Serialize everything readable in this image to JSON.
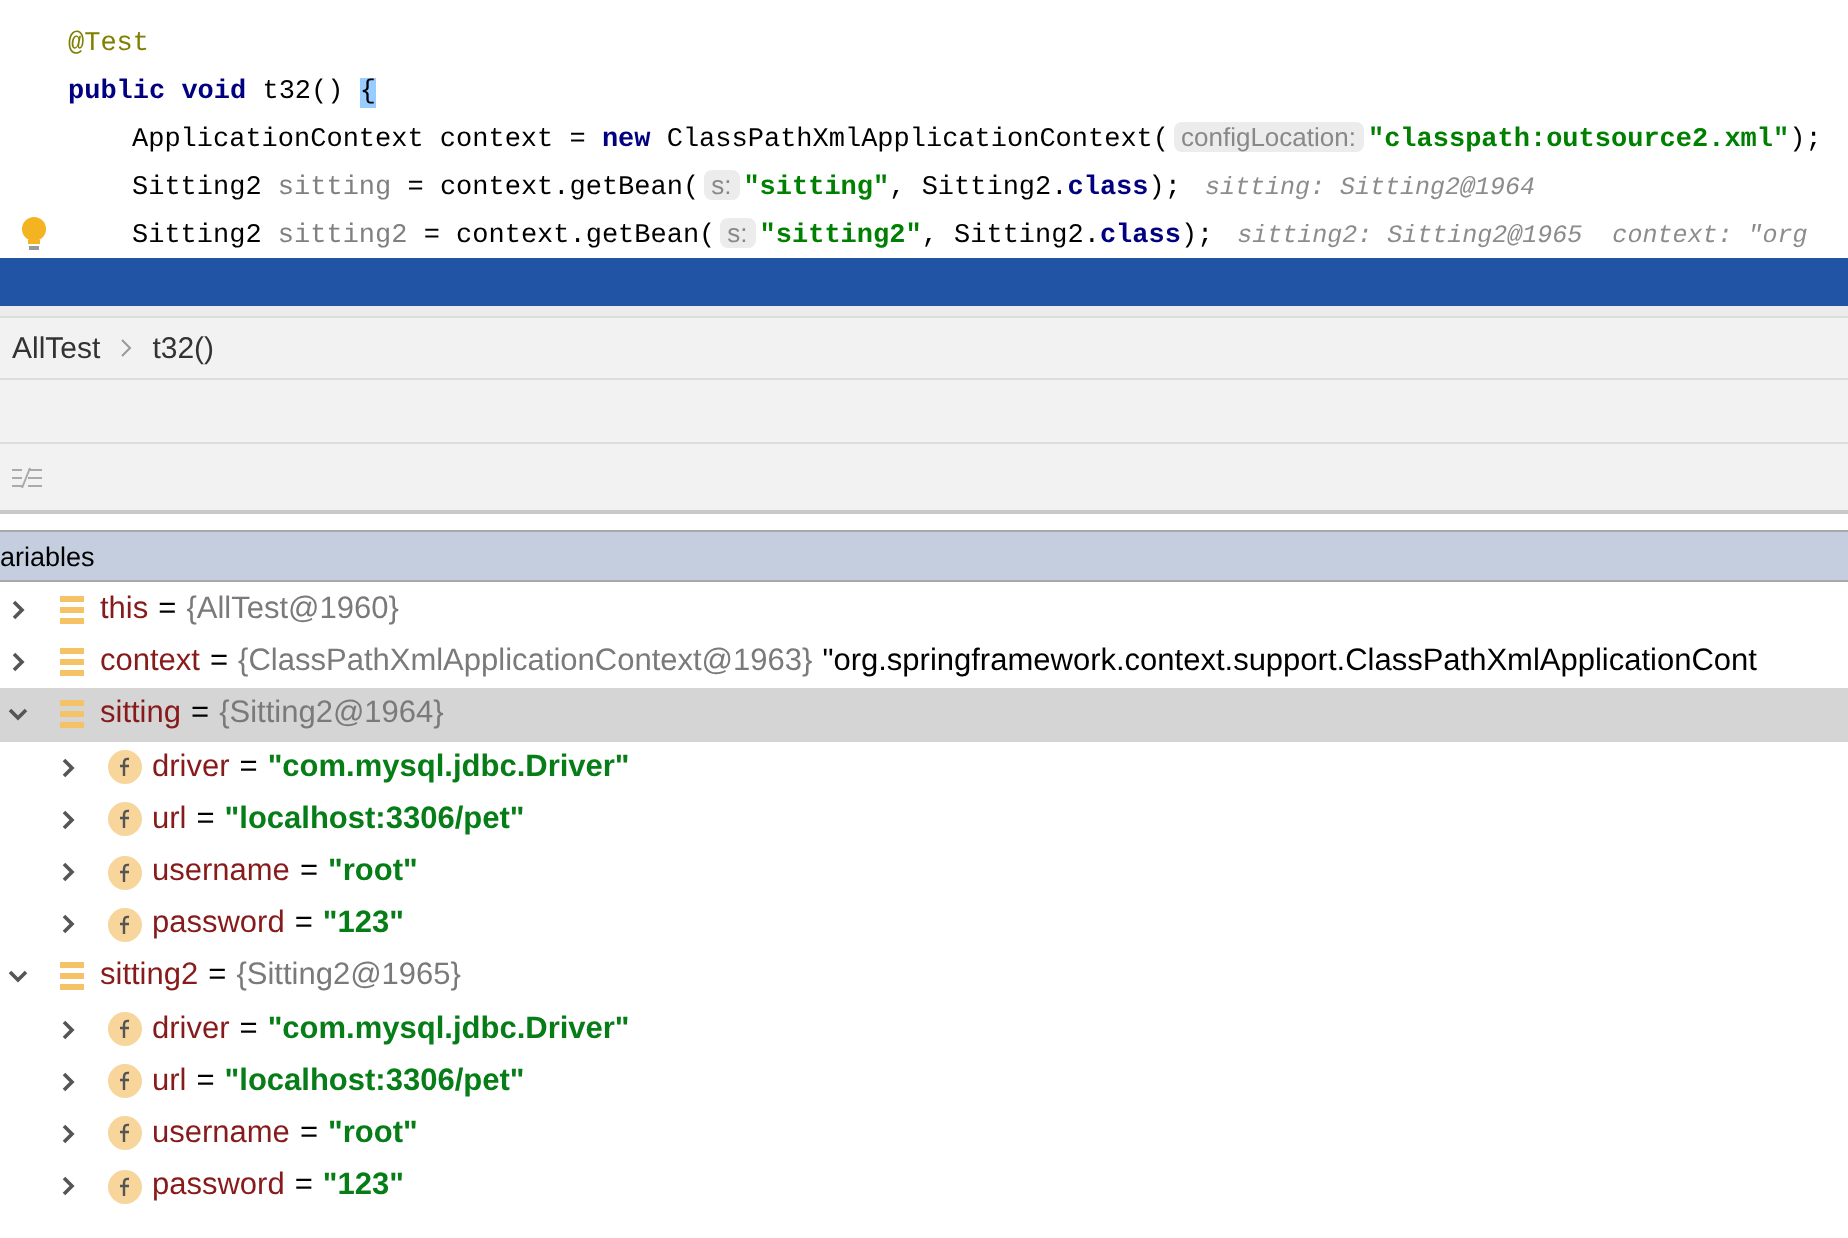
{
  "editor": {
    "lines": [
      {
        "tokens": [
          {
            "kind": "annotation",
            "text": "@Test"
          }
        ]
      },
      {
        "tokens": [
          {
            "kind": "keyword",
            "text": "public void "
          },
          {
            "kind": "plain",
            "text": "t32() "
          },
          {
            "kind": "brace",
            "text": "{"
          }
        ],
        "children": [
          {
            "tokens": [
              {
                "kind": "plain",
                "text": "ApplicationContext context = "
              },
              {
                "kind": "keyword",
                "text": "new "
              },
              {
                "kind": "plain",
                "text": "ClassPathXmlApplicationContext("
              },
              {
                "kind": "hint",
                "text": "configLocation:"
              },
              {
                "kind": "string",
                "text": "\"classpath:outsource2.xml\""
              },
              {
                "kind": "plain",
                "text": ");"
              }
            ]
          },
          {
            "tokens": [
              {
                "kind": "plain",
                "text": "Sitting2 "
              },
              {
                "kind": "unused",
                "text": "sitting"
              },
              {
                "kind": "plain",
                "text": " = context.getBean("
              },
              {
                "kind": "hint",
                "text": "s:"
              },
              {
                "kind": "string",
                "text": "\"sitting\""
              },
              {
                "kind": "plain",
                "text": ", Sitting2."
              },
              {
                "kind": "keyword",
                "text": "class"
              },
              {
                "kind": "plain",
                "text": ");"
              },
              {
                "kind": "inline",
                "text": "sitting: Sitting2@1964"
              }
            ]
          },
          {
            "bulb": true,
            "tokens": [
              {
                "kind": "plain",
                "text": "Sitting2 "
              },
              {
                "kind": "unused",
                "text": "sitting2"
              },
              {
                "kind": "plain",
                "text": " = context.getBean("
              },
              {
                "kind": "hint",
                "text": "s:"
              },
              {
                "kind": "string",
                "text": "\"sitting2\""
              },
              {
                "kind": "plain",
                "text": ", Sitting2."
              },
              {
                "kind": "keyword",
                "text": "class"
              },
              {
                "kind": "plain",
                "text": ");"
              },
              {
                "kind": "inline",
                "text": "sitting2: Sitting2@1965  context: \"org"
              }
            ]
          }
        ]
      },
      {
        "current": true
      }
    ]
  },
  "breadcrumb": [
    "AllTest",
    "t32()"
  ],
  "variables_panel": {
    "title": "ariables",
    "items": [
      {
        "kind": "object",
        "name": "this",
        "op": "=",
        "value": "{AllTest@1960}",
        "expanded": false,
        "selected": false
      },
      {
        "kind": "object",
        "name": "context",
        "op": "=",
        "value": "{ClassPathXmlApplicationContext@1963}",
        "extra": "\"org.springframework.context.support.ClassPathXmlApplicationCont",
        "expanded": false,
        "selected": false
      },
      {
        "kind": "object",
        "name": "sitting",
        "op": "=",
        "value": "{Sitting2@1964}",
        "expanded": true,
        "selected": true,
        "children": [
          {
            "kind": "field",
            "name": "driver",
            "op": "=",
            "value": "\"com.mysql.jdbc.Driver\"",
            "expanded": false,
            "selected": false
          },
          {
            "kind": "field",
            "name": "url",
            "op": "=",
            "value": "\"localhost:3306/pet\"",
            "expanded": false,
            "selected": false
          },
          {
            "kind": "field",
            "name": "username",
            "op": "=",
            "value": "\"root\"",
            "expanded": false,
            "selected": false
          },
          {
            "kind": "field",
            "name": "password",
            "op": "=",
            "value": "\"123\"",
            "expanded": false,
            "selected": false
          }
        ]
      },
      {
        "kind": "object",
        "name": "sitting2",
        "op": "=",
        "value": "{Sitting2@1965}",
        "expanded": true,
        "selected": false,
        "children": [
          {
            "kind": "field",
            "name": "driver",
            "op": "=",
            "value": "\"com.mysql.jdbc.Driver\"",
            "expanded": false,
            "selected": false
          },
          {
            "kind": "field",
            "name": "url",
            "op": "=",
            "value": "\"localhost:3306/pet\"",
            "expanded": false,
            "selected": false
          },
          {
            "kind": "field",
            "name": "username",
            "op": "=",
            "value": "\"root\"",
            "expanded": false,
            "selected": false
          },
          {
            "kind": "field",
            "name": "password",
            "op": "=",
            "value": "\"123\"",
            "expanded": false,
            "selected": false
          }
        ]
      }
    ]
  }
}
